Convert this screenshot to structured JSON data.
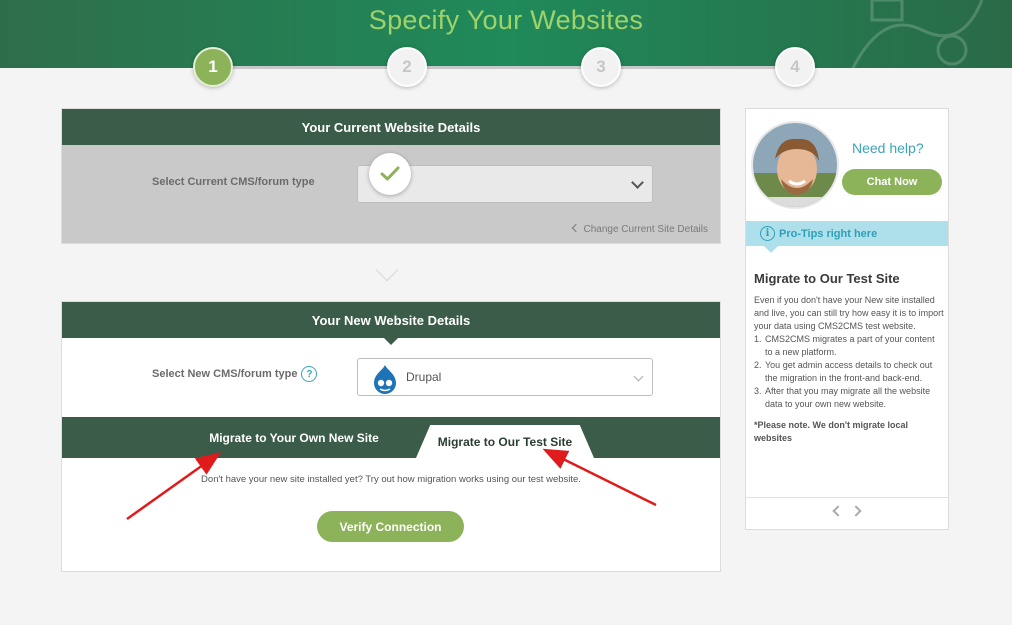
{
  "page": {
    "title": "Specify Your Websites"
  },
  "steps": {
    "labels": [
      "1",
      "2",
      "3",
      "4"
    ],
    "active": 1
  },
  "current_site": {
    "heading": "Your Current Website Details",
    "cms_label": "Select Current CMS/forum type",
    "change_link": "Change Current Site Details"
  },
  "new_site": {
    "heading": "Your New Website Details",
    "cms_label": "Select New CMS/forum type",
    "help_glyph": "?",
    "cms_value": "Drupal",
    "tabs": [
      {
        "label": "Migrate to Your Own New Site",
        "active": false
      },
      {
        "label": "Migrate to Our Test Site",
        "active": true
      }
    ],
    "tab_description": "Don't have your new site installed yet? Try out how migration works using our test website.",
    "verify_button": "Verify Connection"
  },
  "sidebar": {
    "need_help": "Need help?",
    "chat_button": "Chat Now",
    "protips": {
      "info_glyph": "i",
      "label": "Pro-Tips right here"
    },
    "tip_title": "Migrate to Our Test Site",
    "tip_intro": "Even if you don't have your New site installed and live, you can still try how easy it is to import your data using CMS2CMS test website.",
    "tip_items": [
      {
        "num": "1.",
        "text": "CMS2CMS migrates a part of your content to a new platform."
      },
      {
        "num": "2.",
        "text": "You get admin access details to check out the migration in the front-and back-end."
      },
      {
        "num": "3.",
        "text": "After that you may migrate all the website data to your own new website."
      }
    ],
    "tip_note": "*Please note. We don't migrate local websites"
  },
  "colors": {
    "header_bg": "#2e6d4a",
    "title_green": "#9fd36a",
    "accent_green": "#8cb25a",
    "panel_header": "#3b5c48",
    "help_blue": "#3aa6b9",
    "annotation_red": "#e01b1b"
  }
}
